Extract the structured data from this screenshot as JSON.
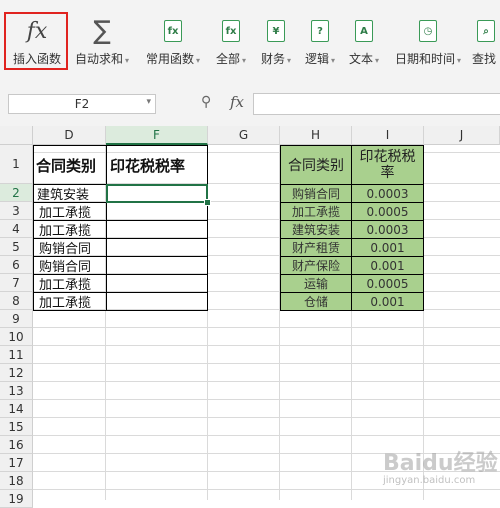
{
  "toolbar": {
    "insert_function": "插入函数",
    "autosum": "自动求和",
    "common_functions": "常用函数",
    "all": "全部",
    "financial": "财务",
    "logical": "逻辑",
    "text": "文本",
    "datetime": "日期和时间",
    "lookup": "查找"
  },
  "formula_bar": {
    "name_box": "F2",
    "fx": "fx",
    "formula": ""
  },
  "columns": [
    "D",
    "F",
    "G",
    "H",
    "I",
    "J"
  ],
  "rows": [
    "1",
    "2",
    "3",
    "4",
    "5",
    "6",
    "7",
    "8",
    "9",
    "10",
    "11",
    "12",
    "13",
    "14",
    "15",
    "16",
    "17",
    "18",
    "19"
  ],
  "contract_table": {
    "header_type": "合同类别",
    "header_rate": "印花税税率",
    "types": [
      "建筑安装",
      "加工承揽",
      "加工承揽",
      "购销合同",
      "购销合同",
      "加工承揽",
      "加工承揽"
    ]
  },
  "rate_table": {
    "header_type": "合同类别",
    "header_rate": "印花税税率",
    "rows": [
      {
        "type": "购销合同",
        "rate": "0.0003"
      },
      {
        "type": "加工承揽",
        "rate": "0.0005"
      },
      {
        "type": "建筑安装",
        "rate": "0.0003"
      },
      {
        "type": "财产租赁",
        "rate": "0.001"
      },
      {
        "type": "财产保险",
        "rate": "0.001"
      },
      {
        "type": "运输",
        "rate": "0.0005"
      },
      {
        "type": "仓储",
        "rate": "0.001"
      }
    ]
  },
  "watermark": {
    "main": "Baidu经验",
    "sub": "jingyan.baidu.com"
  },
  "colors": {
    "accent": "#217346",
    "highlight_red": "#e0231f",
    "ref_fill": "#a9d08e"
  }
}
